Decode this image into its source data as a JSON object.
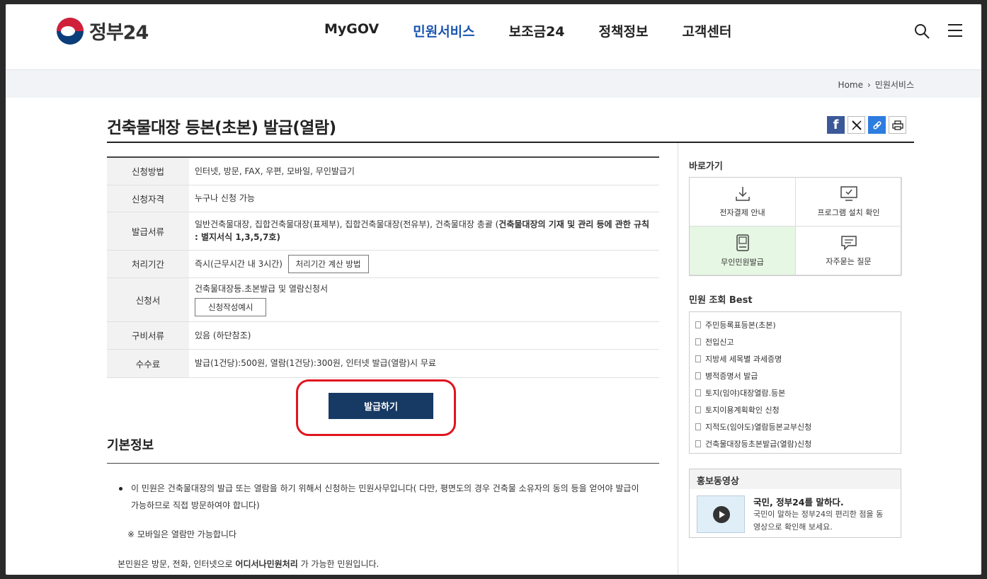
{
  "header": {
    "logo_text": "정부24",
    "nav": [
      "MyGOV",
      "민원서비스",
      "보조금24",
      "정책정보",
      "고객센터"
    ],
    "active_index": 1
  },
  "breadcrumb": {
    "home": "Home",
    "current": "민원서비스"
  },
  "page": {
    "title": "건축물대장 등본(초본) 발급(열람)"
  },
  "table": {
    "rows": [
      {
        "label": "신청방법",
        "value": "인터넷, 방문, FAX, 우편, 모바일, 무인발급기"
      },
      {
        "label": "신청자격",
        "value": "누구나 신청 가능"
      },
      {
        "label": "발급서류",
        "value": "일반건축물대장, 집합건축물대장(표제부), 집합건축물대장(전유부), 건축물대장 총괄 (",
        "value_bold": "건축물대장의 기재 및 관리 등에 관한 규칙 : 별지서식 1,3,5,7호",
        "value_tail": ")"
      },
      {
        "label": "처리기간",
        "value": "즉시(근무시간 내 3시간)",
        "button": "처리기간 계산 방법"
      },
      {
        "label": "신청서",
        "value": "건축물대장등.초본발급 및 열람신청서",
        "button": "신청작성예시"
      },
      {
        "label": "구비서류",
        "value": "있음 (하단참조)"
      },
      {
        "label": "수수료",
        "value": "발급(1건당):500원, 열람(1건당):300원, 인터넷 발급(열람)시 무료"
      }
    ]
  },
  "issue_button": "발급하기",
  "basic": {
    "title": "기본정보",
    "bullet": "이 민원은 건축물대장의 발급 또는 열람을 하기 위해서 신청하는 민원사무입니다( 다만, 평면도의 경우 건축물 소유자의 동의 등을 얻어야 발급이 가능하므로 직접 방문하여야 합니다)",
    "note": "※ 모바일은 열람만 가능합니다",
    "foot_pre": "본민원은 방문, 전화, 인터넷으로 ",
    "foot_bold": "어디서나민원처리",
    "foot_post": " 가 가능한 민원입니다."
  },
  "sidebar": {
    "quick_title": "바로가기",
    "quick": [
      "전자결제 안내",
      "프로그램 설치 확인",
      "무인민원발급",
      "자주묻는 질문"
    ],
    "best_title": "민원 조회 Best",
    "best": [
      "주민등록표등본(초본)",
      "전입신고",
      "지방세 세목별 과세증명",
      "병적증명서 발급",
      "토지(임야)대장열람.등본",
      "토지이용계획확인 신청",
      "지적도(임야도)열람등본교부신청",
      "건축물대장등초본발급(열람)신청"
    ],
    "promo_title": "홍보동영상",
    "promo_headline": "국민, 정부24를 말하다.",
    "promo_desc": "국민이 말하는 정부24의 편리한 점을 동영상으로 확인해 보세요."
  }
}
